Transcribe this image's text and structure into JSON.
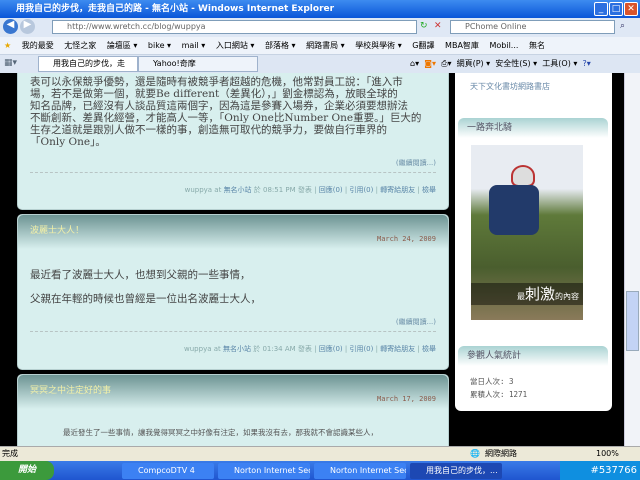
{
  "window": {
    "title": "用我自己的步伐，走我自己的路 - 無名小站 - Windows Internet Explorer"
  },
  "address": {
    "url": "http://www.wretch.cc/blog/wuppya",
    "search_placeholder": "PChome Online"
  },
  "favorites": [
    "我的最愛",
    "尢怪之家",
    "論壇區 ▾",
    "bike ▾",
    "mail ▾",
    "入口網站 ▾",
    "部落格 ▾",
    "網路書局 ▾",
    "學校與學術 ▾",
    "G翻譯",
    "MBA智庫",
    "Mobil...",
    "無名"
  ],
  "tabs": [
    {
      "label": "用我自己的步伐，走我..."
    },
    {
      "label": "Yahoo!奇摩"
    }
  ],
  "command_bar": [
    "網頁(P) ▾",
    "安全性(S) ▾",
    "工具(O) ▾"
  ],
  "posts": [
    {
      "body": [
        "表可以永保競爭優勢，還是隨時有被競爭者超越的危機，他常對員工說：「進入市",
        "場，若不是做第一個，就要Be different（差異化），」劉金標認為，放眼全球的",
        "知名品牌，已經沒有人談品質這兩個字，因為這是參賽入場券，企業必須要想辦法",
        "不斷創新、差異化經營，才能高人一等，「Only One比Number One重要。」巨大的",
        "生存之道就是跟別人做不一樣的事，創造無可取代的競爭力，要做自行車界的",
        "「Only One」。"
      ],
      "more": "(繼續閱讀...)",
      "author": "wuppya",
      "site": "無名小站",
      "time": "於 08:51 PM 發表",
      "reply": "回應(0)",
      "trackback": "引用(0)",
      "forward": "轉寄給朋友",
      "report": "檢舉"
    },
    {
      "title": "波麗士大人！",
      "date": "March 24, 2009",
      "body": [
        "最近看了波麗士大人，也想到父親的一些事情，",
        "父親在年輕的時候也曾經是一位出名波麗士大人，"
      ],
      "more": "(繼續閱讀...)",
      "author": "wuppya",
      "site": "無名小站",
      "time": "於 01:34 AM 發表",
      "reply": "回應(0)",
      "trackback": "引用(0)",
      "forward": "轉寄給朋友",
      "report": "檢舉"
    },
    {
      "title": "冥冥之中注定好的事",
      "date": "March 17, 2009",
      "body": [
        "最近發生了一些事情，讓我覺得冥冥之中好像有注定，如果我沒有去，那我就不會認識某些人，"
      ]
    }
  ],
  "sidebar": {
    "link": "天下文化書坊網路書店",
    "widget1": "一路奔北騎",
    "image_caption_small": "最",
    "image_caption_big": "刺激",
    "image_caption_end": "的內容",
    "widget2": "參觀人氣統計",
    "today": "當日人次: 3",
    "total": "累積人次: 1271"
  },
  "status": {
    "text": "完成",
    "zone": "網際網路",
    "zoom": "100%"
  },
  "taskbar": {
    "start": "開始",
    "items": [
      "CompcoDTV 4",
      "Norton Internet Secu...",
      "Norton Internet Secu...",
      "用我自己的步伐，..."
    ],
    "tray": "#537766"
  }
}
